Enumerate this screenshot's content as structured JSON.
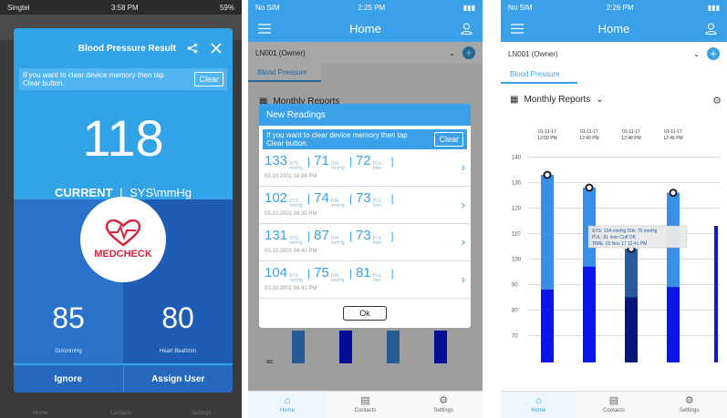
{
  "panel1": {
    "status": {
      "carrier": "Singtel",
      "time": "3:58 PM",
      "battery": "59%"
    },
    "card": {
      "title": "Blood Pressure Result",
      "clear_msg": "If you want to clear device memory then tap Clear button.",
      "clear_label": "Clear",
      "sys_value": "118",
      "current_label": "CURRENT",
      "unit_label": "SYS\\mmHg",
      "logo_text": "MEDCHECK",
      "dia_value": "85",
      "dia_label": "DIA\\mmHg",
      "pulse_value": "80",
      "pulse_label": "Heart Beat\\min",
      "ignore_label": "Ignore",
      "assign_label": "Assign User"
    },
    "tabs": [
      "Home",
      "Contacts",
      "Settings"
    ]
  },
  "panel2": {
    "status": {
      "carrier": "No SIM",
      "time": "2:25 PM"
    },
    "nav_title": "Home",
    "user": "LN001 (Owner)",
    "tab": "Blood Pressure",
    "monthly": "Monthly Reports",
    "axis_fragment": "ac",
    "modal": {
      "title": "New Readings",
      "clear_msg": "If you want to clear device memory then tap Clear button.",
      "clear_label": "Clear",
      "sys_unit": "SYS mmHg",
      "dia_unit": "DIA mmHg",
      "pul_unit": "PUL /min",
      "readings": [
        {
          "sys": "133",
          "dia": "71",
          "pul": "72",
          "date": "03.10.2001 04:34 PM"
        },
        {
          "sys": "102",
          "dia": "74",
          "pul": "73",
          "date": "03.10.2001 04:35 PM"
        },
        {
          "sys": "131",
          "dia": "87",
          "pul": "73",
          "date": "03.10.2001 04:40 PM"
        },
        {
          "sys": "104",
          "dia": "75",
          "pul": "81",
          "date": "03.10.2001 04:41 PM"
        }
      ],
      "ok_label": "Ok"
    },
    "tabs": [
      "Home",
      "Contacts",
      "Settings"
    ]
  },
  "panel3": {
    "status": {
      "carrier": "No SIM",
      "time": "2:26 PM"
    },
    "nav_title": "Home",
    "user": "LN001 (Owner)",
    "tab": "Blood Pressure",
    "monthly": "Monthly Reports",
    "tooltip": {
      "line1": "SYS: 104 mmHg  DIA: 75 mmHg",
      "line2": "PUL: 81 /min  Cuff OK",
      "line3": "TIME: 03 Nov 17 12:41 PM"
    },
    "tabs": [
      "Home",
      "Contacts",
      "Settings"
    ]
  },
  "chart_data": {
    "type": "bar",
    "categories": [
      "01-11-17 12:50 PM",
      "01-11-17 12:49 PM",
      "01-11-17 12:48 PM",
      "01-11-17 12:45 PM"
    ],
    "series": [
      {
        "name": "SYS",
        "values": [
          133,
          128,
          104,
          126
        ]
      },
      {
        "name": "DIA",
        "values": [
          88,
          97,
          85,
          89
        ]
      }
    ],
    "yticks": [
      70,
      80,
      90,
      100,
      110,
      120,
      130,
      140
    ],
    "ylim": [
      63,
      143
    ],
    "colors": {
      "sys": "#3a8ee6",
      "dia": "#0a16e8",
      "sys_selected": "#2a5aa0",
      "dia_selected": "#06157a"
    },
    "selected_index": 2
  }
}
